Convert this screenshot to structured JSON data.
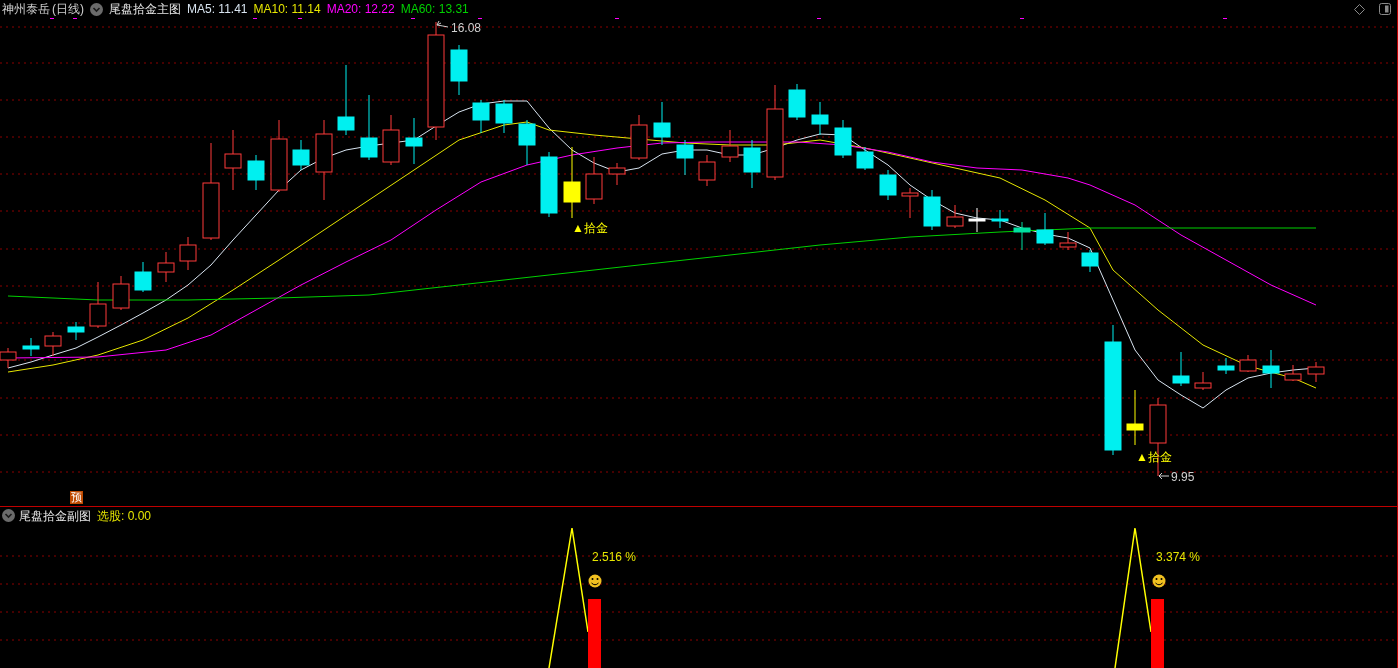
{
  "main_chart": {
    "stock": "神州泰岳",
    "period": "(日线)",
    "indicator": "尾盘拾金主图",
    "moving_averages": [
      {
        "label": "MA5: 11.41",
        "color": "#d8e4f0"
      },
      {
        "label": "MA10: 11.14",
        "color": "#e6e600"
      },
      {
        "label": "MA20: 12.22",
        "color": "#ff00ff"
      },
      {
        "label": "MA60: 13.31",
        "color": "#00d000"
      }
    ],
    "high_label": "16.08",
    "low_label": "9.95",
    "signals": [
      "▲拾金",
      "▲拾金"
    ],
    "badge": "预"
  },
  "sub_chart": {
    "indicator": "尾盘拾金副图",
    "reading": "选股: 0.00",
    "percent_labels": [
      "2.516 %",
      "3.374 %"
    ]
  }
}
